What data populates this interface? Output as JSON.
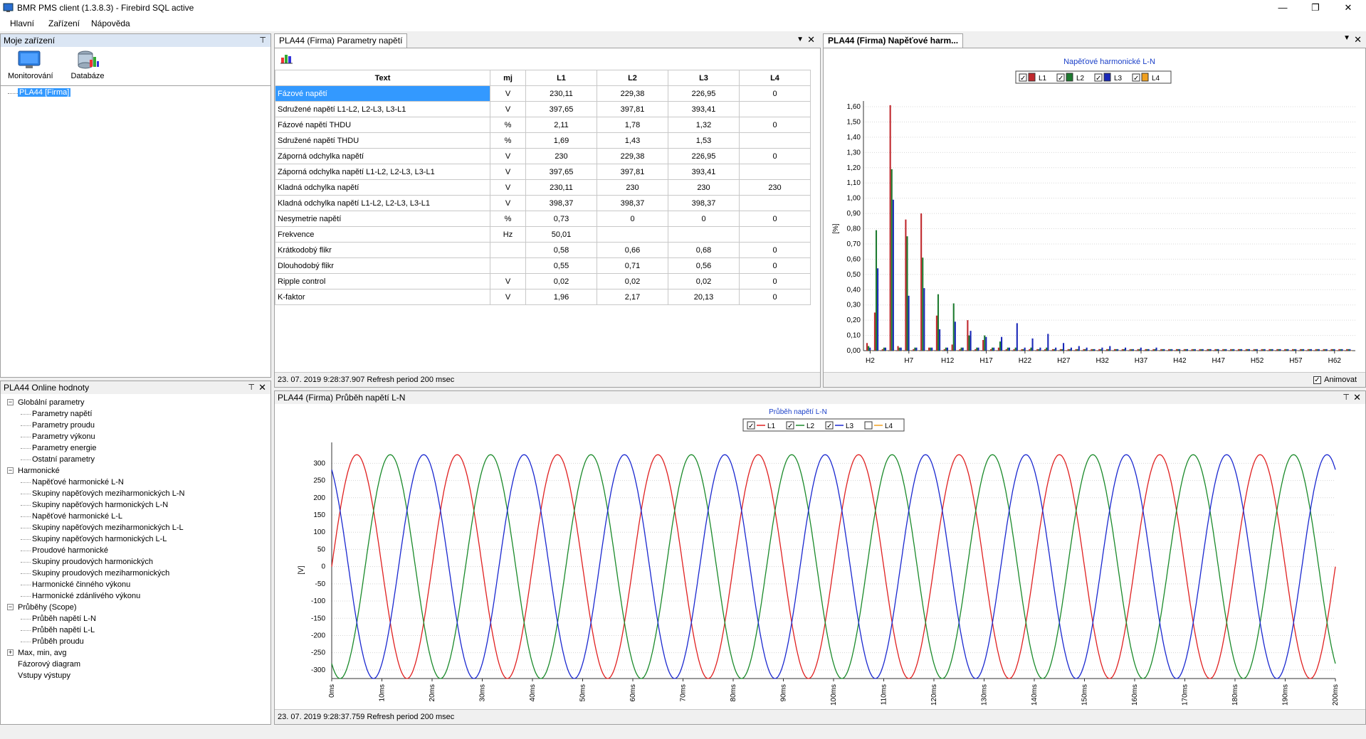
{
  "window": {
    "title": "BMR PMS client (1.3.8.3) - Firebird SQL active"
  },
  "menu": [
    "Hlavní",
    "Zařízení",
    "Nápověda"
  ],
  "devices_panel": {
    "title": "Moje zařízení",
    "buttons": {
      "monitoring": "Monitorování",
      "database": "Databáze"
    },
    "tree_item": "PLA44 [Firma]"
  },
  "online_panel": {
    "title": "PLA44 Online hodnoty",
    "groups": [
      {
        "label": "Globální parametry",
        "items": [
          "Parametry napětí",
          "Parametry proudu",
          "Parametry výkonu",
          "Parametry energie",
          "Ostatní parametry"
        ]
      },
      {
        "label": "Harmonické",
        "items": [
          "Napěťové harmonické L-N",
          "Skupiny napěťových meziharmonických L-N",
          "Skupiny napěťových harmonických L-N",
          "Napěťové harmonické L-L",
          "Skupiny napěťových meziharmonických L-L",
          "Skupiny napěťových harmonických L-L",
          "Proudové harmonické",
          "Skupiny proudových harmonických",
          "Skupiny proudových meziharmonických",
          "Harmonické činného výkonu",
          "Harmonické zdánlivého výkonu"
        ]
      },
      {
        "label": "Průběhy (Scope)",
        "items": [
          "Průběh napětí L-N",
          "Průběh napětí L-L",
          "Průběh proudu"
        ]
      }
    ],
    "extra": [
      "Max, min, avg",
      "Fázorový diagram",
      "Vstupy výstupy"
    ]
  },
  "params_panel": {
    "tab": "PLA44 (Firma) Parametry napětí",
    "columns": [
      "Text",
      "mj",
      "L1",
      "L2",
      "L3",
      "L4"
    ],
    "rows": [
      [
        "Fázové napětí",
        "V",
        "230,11",
        "229,38",
        "226,95",
        "0"
      ],
      [
        "Sdružené napětí L1-L2, L2-L3, L3-L1",
        "V",
        "397,65",
        "397,81",
        "393,41",
        ""
      ],
      [
        "Fázové napětí THDU",
        "%",
        "2,11",
        "1,78",
        "1,32",
        "0"
      ],
      [
        "Sdružené napětí THDU",
        "%",
        "1,69",
        "1,43",
        "1,53",
        ""
      ],
      [
        "Záporná odchylka napětí",
        "V",
        "230",
        "229,38",
        "226,95",
        "0"
      ],
      [
        "Záporná odchylka napětí L1-L2, L2-L3, L3-L1",
        "V",
        "397,65",
        "397,81",
        "393,41",
        ""
      ],
      [
        "Kladná odchylka napětí",
        "V",
        "230,11",
        "230",
        "230",
        "230"
      ],
      [
        "Kladná odchylka napětí L1-L2, L2-L3, L3-L1",
        "V",
        "398,37",
        "398,37",
        "398,37",
        ""
      ],
      [
        "Nesymetrie napětí",
        "%",
        "0,73",
        "0",
        "0",
        "0"
      ],
      [
        "Frekvence",
        "Hz",
        "50,01",
        "",
        "",
        ""
      ],
      [
        "Krátkodobý flikr",
        "",
        "0,58",
        "0,66",
        "0,68",
        "0"
      ],
      [
        "Dlouhodobý flikr",
        "",
        "0,55",
        "0,71",
        "0,56",
        "0"
      ],
      [
        "Ripple control",
        "V",
        "0,02",
        "0,02",
        "0,02",
        "0"
      ],
      [
        "K-faktor",
        "V",
        "1,96",
        "2,17",
        "20,13",
        "0"
      ]
    ],
    "status": "23. 07. 2019 9:28:37.907  Refresh period 200 msec"
  },
  "harm_panel": {
    "tab": "PLA44 (Firma) Napěťové harm...",
    "animate_label": "Animovat",
    "chart_data": {
      "type": "bar",
      "title": "Napěťové harmonické L-N",
      "ylabel": "[%]",
      "ylim": [
        0,
        1.6
      ],
      "yticks": [
        "0,00",
        "0,10",
        "0,20",
        "0,30",
        "0,40",
        "0,50",
        "0,60",
        "0,70",
        "0,80",
        "0,90",
        "1,00",
        "1,10",
        "1,20",
        "1,30",
        "1,40",
        "1,50",
        "1,60"
      ],
      "xticks": [
        "H2",
        "H7",
        "H12",
        "H17",
        "H22",
        "H27",
        "H32",
        "H37",
        "H42",
        "H47",
        "H52",
        "H57",
        "H62"
      ],
      "x_start": 2,
      "x_end": 64,
      "series": [
        {
          "name": "L1",
          "color": "#c0282d",
          "values": [
            0.05,
            0.25,
            0.01,
            1.61,
            0.03,
            0.86,
            0.01,
            0.9,
            0.02,
            0.23,
            0.01,
            0.04,
            0.01,
            0.2,
            0.01,
            0.07,
            0.01,
            0.02,
            0.01,
            0.01,
            0.01,
            0.01,
            0.01,
            0.01,
            0.01,
            0.01,
            0.01,
            0.01,
            0.01,
            0.01,
            0.01,
            0.01,
            0.01,
            0.01,
            0.01,
            0.01,
            0.01,
            0.01,
            0.01,
            0.01,
            0.01,
            0.01,
            0.01,
            0.01,
            0.01,
            0.01,
            0.01,
            0.01,
            0.01,
            0.01,
            0.01,
            0.01,
            0.01,
            0.01,
            0.01,
            0.01,
            0.01,
            0.01,
            0.01,
            0.01,
            0.01,
            0.01,
            0.01
          ]
        },
        {
          "name": "L2",
          "color": "#1e7b30",
          "values": [
            0.03,
            0.79,
            0.02,
            1.19,
            0.02,
            0.75,
            0.02,
            0.61,
            0.02,
            0.37,
            0.02,
            0.31,
            0.02,
            0.1,
            0.02,
            0.1,
            0.02,
            0.06,
            0.02,
            0.02,
            0.01,
            0.02,
            0.01,
            0.02,
            0.01,
            0.01,
            0.01,
            0.01,
            0.01,
            0.01,
            0.01,
            0.01,
            0.01,
            0.01,
            0.01,
            0.01,
            0.01,
            0.01,
            0.01,
            0.01,
            0.01,
            0.01,
            0.01,
            0.01,
            0.01,
            0.01,
            0.01,
            0.01,
            0.01,
            0.01,
            0.01,
            0.01,
            0.01,
            0.01,
            0.01,
            0.01,
            0.01,
            0.01,
            0.01,
            0.01,
            0.01,
            0.01,
            0.01
          ]
        },
        {
          "name": "L3",
          "color": "#1a28b8",
          "values": [
            0.02,
            0.54,
            0.02,
            0.99,
            0.02,
            0.36,
            0.02,
            0.41,
            0.02,
            0.14,
            0.02,
            0.19,
            0.02,
            0.13,
            0.02,
            0.09,
            0.02,
            0.09,
            0.02,
            0.18,
            0.02,
            0.08,
            0.02,
            0.11,
            0.02,
            0.05,
            0.02,
            0.03,
            0.02,
            0.01,
            0.02,
            0.03,
            0.01,
            0.02,
            0.01,
            0.02,
            0.01,
            0.02,
            0.01,
            0.01,
            0.01,
            0.01,
            0.01,
            0.01,
            0.01,
            0.01,
            0.01,
            0.01,
            0.01,
            0.01,
            0.01,
            0.01,
            0.01,
            0.01,
            0.01,
            0.01,
            0.01,
            0.01,
            0.01,
            0.01,
            0.01,
            0.01,
            0.01
          ]
        },
        {
          "name": "L4",
          "color": "#f0a020",
          "values": [
            0,
            0,
            0,
            0,
            0,
            0,
            0,
            0,
            0,
            0,
            0,
            0,
            0,
            0,
            0,
            0,
            0,
            0,
            0,
            0,
            0,
            0,
            0,
            0,
            0,
            0,
            0,
            0,
            0,
            0,
            0,
            0,
            0,
            0,
            0,
            0,
            0,
            0,
            0,
            0,
            0,
            0,
            0,
            0,
            0,
            0,
            0,
            0,
            0,
            0,
            0,
            0,
            0,
            0,
            0,
            0,
            0,
            0,
            0,
            0,
            0,
            0,
            0
          ]
        }
      ],
      "legend_checked": [
        true,
        true,
        true,
        true
      ]
    }
  },
  "scope_panel": {
    "title": "PLA44 (Firma) Průběh napětí L-N",
    "status": "23. 07. 2019 9:28:37.759  Refresh period 200 msec",
    "chart_data": {
      "type": "line",
      "title": "Průběh napětí L-N",
      "ylabel": "[V]",
      "ylim": [
        -325,
        340
      ],
      "yticks": [
        300,
        250,
        200,
        150,
        100,
        50,
        0,
        -50,
        -100,
        -150,
        -200,
        -250,
        -300
      ],
      "xlim_ms": [
        0,
        200
      ],
      "xticks": [
        "0ms",
        "10ms",
        "20ms",
        "30ms",
        "40ms",
        "50ms",
        "60ms",
        "70ms",
        "80ms",
        "90ms",
        "100ms",
        "110ms",
        "120ms",
        "130ms",
        "140ms",
        "150ms",
        "160ms",
        "170ms",
        "180ms",
        "190ms",
        "200ms"
      ],
      "amplitude_v": 325,
      "frequency_hz": 50,
      "series": [
        {
          "name": "L1",
          "color": "#e02020",
          "phase_deg": 0,
          "checked": true
        },
        {
          "name": "L2",
          "color": "#1a8a2a",
          "phase_deg": -120,
          "checked": true
        },
        {
          "name": "L3",
          "color": "#1a28d0",
          "phase_deg": 120,
          "checked": true
        },
        {
          "name": "L4",
          "color": "#f0a020",
          "phase_deg": 0,
          "checked": false
        }
      ]
    }
  }
}
